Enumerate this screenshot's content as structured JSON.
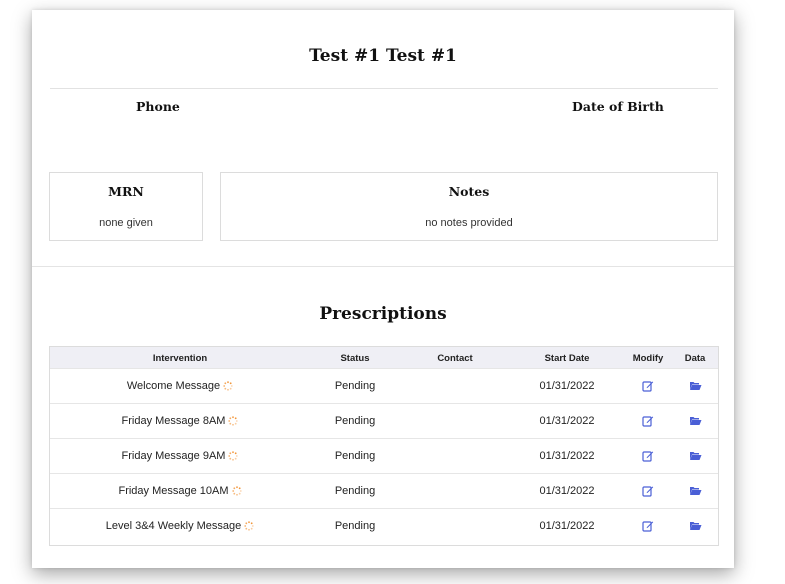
{
  "patient": {
    "name": "Test #1 Test #1",
    "phone_label": "Phone",
    "dob_label": "Date of Birth",
    "mrn_label": "MRN",
    "mrn_value": "none given",
    "notes_label": "Notes",
    "notes_value": "no notes provided"
  },
  "prescriptions": {
    "title": "Prescriptions",
    "columns": [
      "Intervention",
      "Status",
      "Contact",
      "Start Date",
      "Modify",
      "Data"
    ],
    "rows": [
      {
        "intervention": "Welcome Message",
        "status": "Pending",
        "contact": "",
        "start_date": "01/31/2022"
      },
      {
        "intervention": "Friday Message 8AM",
        "status": "Pending",
        "contact": "",
        "start_date": "01/31/2022"
      },
      {
        "intervention": "Friday Message 9AM",
        "status": "Pending",
        "contact": "",
        "start_date": "01/31/2022"
      },
      {
        "intervention": "Friday Message 10AM",
        "status": "Pending",
        "contact": "",
        "start_date": "01/31/2022"
      },
      {
        "intervention": "Level 3&4 Weekly Message",
        "status": "Pending",
        "contact": "",
        "start_date": "01/31/2022"
      }
    ]
  },
  "icons": {
    "pending": "loading-spinner-icon",
    "modify": "edit-icon",
    "data": "folder-open-icon"
  },
  "colors": {
    "icon_blue": "#4a5fd6",
    "spinner_orange": "#f08a24",
    "table_header_bg": "#efeff5"
  }
}
